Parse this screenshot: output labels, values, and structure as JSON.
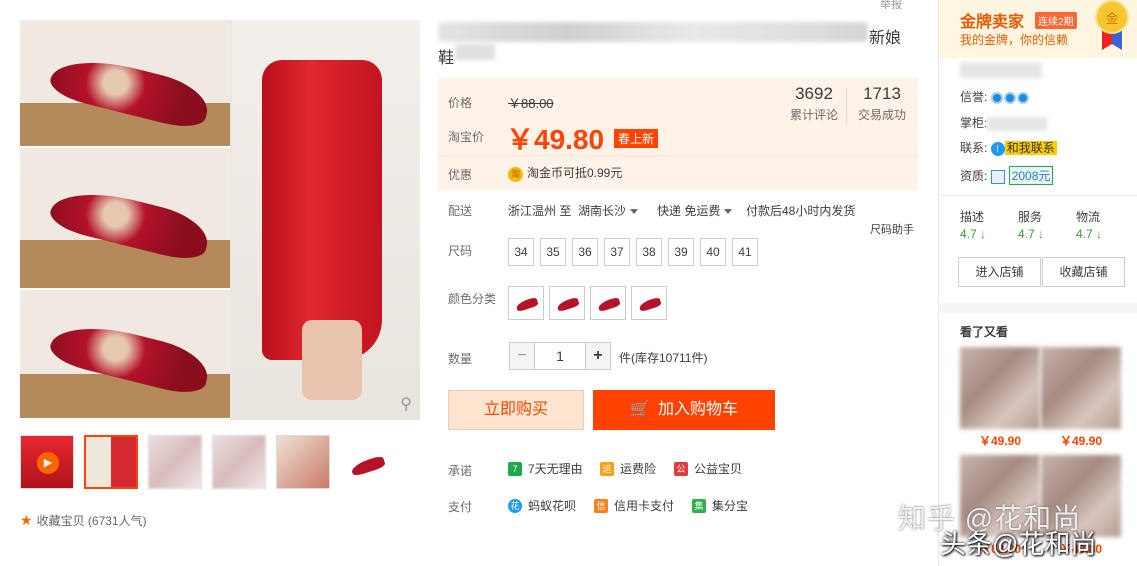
{
  "title": {
    "part1": "新娘",
    "part2": "鞋",
    "report": "举报"
  },
  "price": {
    "label": "价格",
    "original": "￥88.00",
    "taobao_label": "淘宝价",
    "current": "￥49.80",
    "badge": "春上新",
    "reviews": {
      "value": "3692",
      "label": "累计评论"
    },
    "sales": {
      "value": "1713",
      "label": "交易成功"
    },
    "promo_label": "优惠",
    "promo_icon": "淘",
    "promo_text": "淘金币可抵0.99元"
  },
  "shipping": {
    "label": "配送",
    "from": "浙江温州 至",
    "to": "湖南长沙",
    "express": "快递 免运费",
    "dispatch": "付款后48小时内发货"
  },
  "size": {
    "label": "尺码",
    "helper": "尺码助手",
    "options": [
      "34",
      "35",
      "36",
      "37",
      "38",
      "39",
      "40",
      "41"
    ]
  },
  "color": {
    "label": "颜色分类"
  },
  "quantity": {
    "label": "数量",
    "value": "1",
    "stock": "件(库存10711件)",
    "minus": "−",
    "plus": "+"
  },
  "actions": {
    "buy_now": "立即购买",
    "add_cart": "加入购物车"
  },
  "promises": {
    "label": "承诺",
    "items": [
      {
        "icon": "7",
        "text": "7天无理由",
        "color": "#20a84c"
      },
      {
        "icon": "运",
        "text": "运费险",
        "color": "#f5a21b"
      },
      {
        "icon": "公",
        "text": "公益宝贝",
        "color": "#e03c3c"
      }
    ]
  },
  "payment": {
    "label": "支付",
    "items": [
      {
        "icon": "花",
        "text": "蚂蚁花呗",
        "color": "#1e9bf0"
      },
      {
        "icon": "信",
        "text": "信用卡支付",
        "color": "#f58220"
      },
      {
        "icon": "集",
        "text": "集分宝",
        "color": "#2fb24c"
      }
    ]
  },
  "favorite": {
    "text": "收藏宝贝 (6731人气)"
  },
  "gallery": {
    "play_icon": "▶",
    "zoom_icon": "⚲"
  },
  "seller": {
    "title": "金牌卖家",
    "badge": "连续2期",
    "subtitle": "我的金牌，你的信赖",
    "medal": "金",
    "credit_label": "信誉:",
    "keeper_label": "掌柜:",
    "contact_label": "联系:",
    "contact_link": "和我联系",
    "qual_label": "资质:",
    "year": "2008元",
    "scores": [
      {
        "label": "描述",
        "value": "4.7 ↓"
      },
      {
        "label": "服务",
        "value": "4.7 ↓"
      },
      {
        "label": "物流",
        "value": "4.7 ↓"
      }
    ],
    "enter_shop": "进入店铺",
    "fav_shop": "收藏店铺"
  },
  "also_seen": {
    "title": "看了又看",
    "prices": [
      "￥49.90",
      "￥49.90",
      "￥68.00",
      "￥49.80"
    ]
  },
  "watermark": {
    "line1": "知乎 @花和尚",
    "line2": "头条@花和尚"
  }
}
